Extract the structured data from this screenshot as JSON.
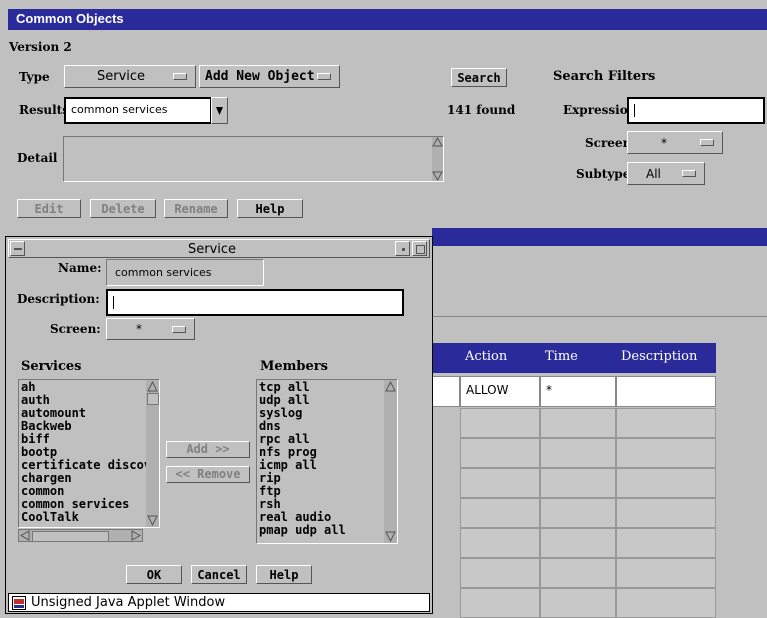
{
  "main": {
    "title": "Common Objects",
    "version": "Version 2",
    "type_label": "Type",
    "type_value": "Service",
    "add_new_label": "Add New Object",
    "search_label": "Search",
    "search_filters_label": "Search Filters",
    "results_label": "Results",
    "results_value": "common services",
    "found_text": "141 found",
    "expression_label": "Expression",
    "expression_value": "",
    "screen_label": "Screen",
    "screen_value": "*",
    "subtype_label": "Subtype",
    "subtype_value": "All",
    "detail_label": "Detail",
    "buttons": {
      "edit": "Edit",
      "delete": "Delete",
      "rename": "Rename",
      "help": "Help"
    },
    "table": {
      "headers": [
        "Action",
        "Time",
        "Description"
      ],
      "rows": [
        [
          "ALLOW",
          "*",
          ""
        ]
      ]
    }
  },
  "dialog": {
    "title": "Service",
    "name_label": "Name:",
    "name_value": "common services",
    "description_label": "Description:",
    "description_value": "",
    "screen_label": "Screen:",
    "screen_value": "*",
    "services_label": "Services",
    "members_label": "Members",
    "services": [
      "ah",
      "auth",
      "automount",
      "Backweb",
      "biff",
      "bootp",
      "certificate discove",
      "chargen",
      "common",
      "common services",
      "CoolTalk"
    ],
    "members": [
      "tcp all",
      "udp all",
      "syslog",
      "dns",
      "rpc all",
      "nfs prog",
      "icmp all",
      "rip",
      "ftp",
      "rsh",
      "real audio",
      "pmap udp all"
    ],
    "add_label": "Add >>",
    "remove_label": "<< Remove",
    "ok_label": "OK",
    "cancel_label": "Cancel",
    "help_label": "Help",
    "status_text": "Unsigned Java Applet Window"
  }
}
